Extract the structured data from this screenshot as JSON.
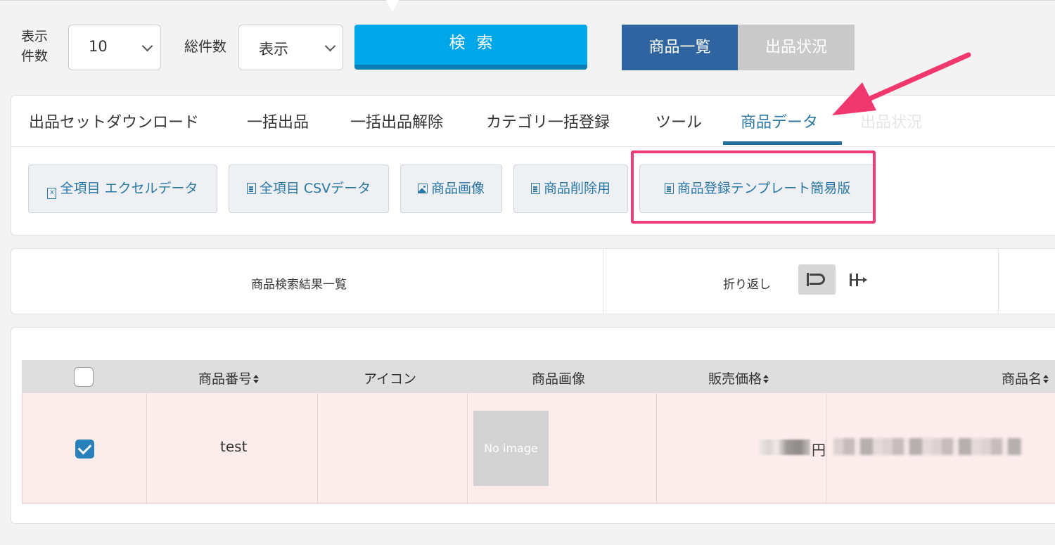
{
  "toolbar": {
    "per_page_label_1": "表示",
    "per_page_label_2": "件数",
    "per_page_value": "10",
    "total_label": "総件数",
    "total_value": "表示",
    "search_label": "検索",
    "view_active": "商品一覧",
    "view_inactive": "出品状況"
  },
  "tabs": [
    {
      "label": "出品セットダウンロード"
    },
    {
      "label": "一括出品"
    },
    {
      "label": "一括出品解除"
    },
    {
      "label": "カテゴリ一括登録"
    },
    {
      "label": "ツール"
    },
    {
      "label": "商品データ"
    },
    {
      "label": "出品状況"
    }
  ],
  "downloads": [
    {
      "label": "全項目 エクセルデータ",
      "icon": "excel-file-icon"
    },
    {
      "label": "全項目 CSVデータ",
      "icon": "document-icon"
    },
    {
      "label": "商品画像",
      "icon": "image-icon"
    },
    {
      "label": "商品削除用",
      "icon": "document-icon"
    },
    {
      "label": "商品登録テンプレート簡易版",
      "icon": "document-icon"
    }
  ],
  "results": {
    "title": "商品検索結果一覧",
    "wrap_label": "折り返し"
  },
  "table": {
    "headers": [
      "商品番号",
      "アイコン",
      "商品画像",
      "販売価格",
      "商品名"
    ],
    "rows": [
      {
        "checked": true,
        "product_number": "test",
        "image_placeholder": "No image",
        "price_suffix": "円"
      }
    ]
  },
  "colors": {
    "accent_blue": "#00a7e8",
    "active_tab": "#2a77a4",
    "highlight": "#ef3b79",
    "row_selected_bg": "#fdecec"
  }
}
